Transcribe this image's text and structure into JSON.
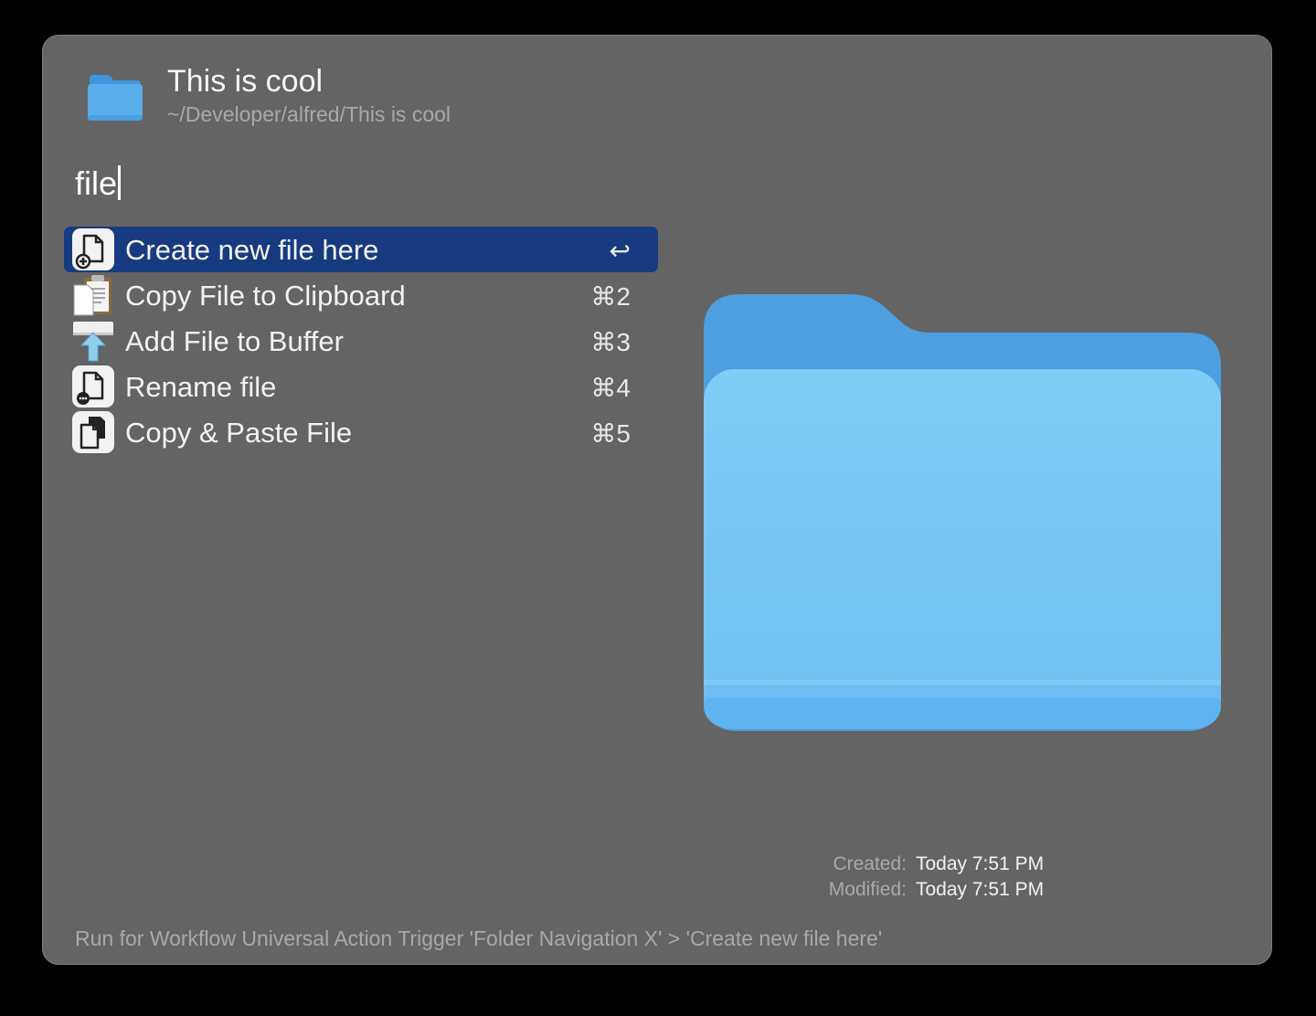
{
  "window": {
    "title": "This is cool",
    "subtitle": "~/Developer/alfred/This is cool",
    "folder_icon": "folder-icon"
  },
  "search": {
    "query": "file"
  },
  "results": [
    {
      "label": "Create new file here",
      "shortcut": "↩",
      "icon": "new-file-icon",
      "selected": true
    },
    {
      "label": "Copy File to Clipboard",
      "shortcut": "⌘2",
      "icon": "clipboard-icon",
      "selected": false
    },
    {
      "label": "Add File to Buffer",
      "shortcut": "⌘3",
      "icon": "buffer-upload-icon",
      "selected": false
    },
    {
      "label": "Rename file",
      "shortcut": "⌘4",
      "icon": "rename-file-icon",
      "selected": false
    },
    {
      "label": "Copy & Paste File",
      "shortcut": "⌘5",
      "icon": "copy-paste-icon",
      "selected": false
    }
  ],
  "preview": {
    "icon": "large-folder-icon",
    "created_label": "Created:",
    "created_value": "Today 7:51 PM",
    "modified_label": "Modified:",
    "modified_value": "Today 7:51 PM"
  },
  "footer": {
    "text": "Run for Workflow Universal Action Trigger 'Folder Navigation X' > 'Create new file here'"
  },
  "colors": {
    "window_bg": "#646464",
    "selection": "#173b80",
    "folder_blue": "#5fb3ef",
    "folder_light": "#7dc8f5"
  }
}
